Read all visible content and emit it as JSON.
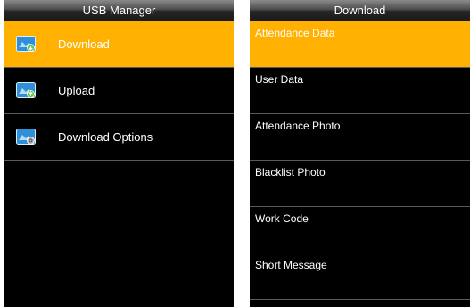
{
  "left_screen": {
    "title": "USB Manager",
    "items": [
      {
        "label": "Download",
        "icon": "download-icon",
        "selected": true
      },
      {
        "label": "Upload",
        "icon": "upload-icon",
        "selected": false
      },
      {
        "label": "Download Options",
        "icon": "download-options-icon",
        "selected": false
      }
    ]
  },
  "right_screen": {
    "title": "Download",
    "items": [
      {
        "label": "Attendance Data",
        "selected": true
      },
      {
        "label": "User Data",
        "selected": false
      },
      {
        "label": "Attendance Photo",
        "selected": false
      },
      {
        "label": "Blacklist Photo",
        "selected": false
      },
      {
        "label": "Work Code",
        "selected": false
      },
      {
        "label": "Short Message",
        "selected": false
      }
    ]
  },
  "colors": {
    "selected": "#ffb000",
    "screen_bg": "#000000",
    "icon_blue": "#2f8fd8",
    "icon_green": "#52c234",
    "icon_grey": "#bdbdbd"
  }
}
